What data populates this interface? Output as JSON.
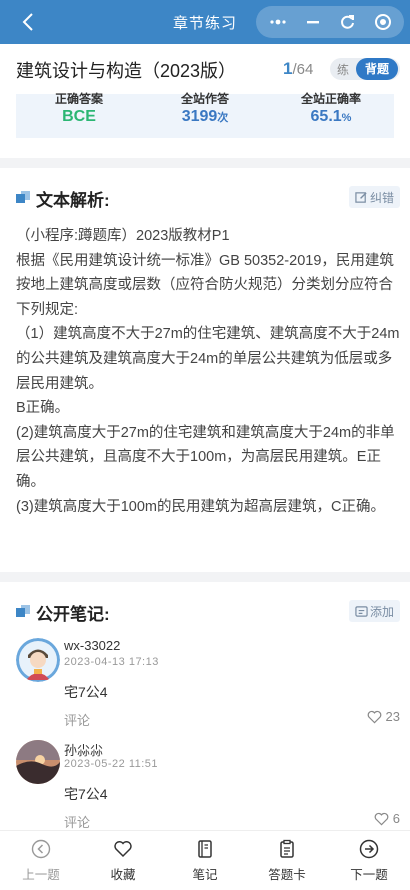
{
  "topbar": {
    "title": "章节练习",
    "back_icon": "chevron-left-icon",
    "capsule_icons": [
      "more-dots-icon",
      "minimize-icon",
      "refresh-icon",
      "target-icon"
    ]
  },
  "header": {
    "book_title": "建筑设计与构造（2023版）",
    "current_page": "1",
    "total_pages": "/64",
    "mode_practice": "练",
    "mode_recite": "背题"
  },
  "stats": {
    "correct_answer_label": "正确答案",
    "correct_answer_value": "BCE",
    "site_attempts_label": "全站作答",
    "site_attempts_value": "3199",
    "site_attempts_unit": "次",
    "site_accuracy_label": "全站正确率",
    "site_accuracy_value": "65.1",
    "site_accuracy_unit": "%"
  },
  "analysis": {
    "title": "文本解析:",
    "report_label": "纠错",
    "lines": [
      "（小程序:蹲题库）2023版教材P1",
      "根据《民用建筑设计统一标准》GB 50352-2019，民用建筑按地上建筑高度或层数（应符合防火规范）分类划分应符合下列规定:",
      "（1）建筑高度不大于27m的住宅建筑、建筑高度不大于24m的公共建筑及建筑高度大于24m的单层公共建筑为低层或多层民用建筑。",
      "B正确。",
      "(2)建筑高度大于27m的住宅建筑和建筑高度大于24m的非单层公共建筑，且高度不大于100m，为高层民用建筑。E正确。",
      "(3)建筑高度大于100m的民用建筑为超高层建筑，C正确。"
    ]
  },
  "notes": {
    "title": "公开笔记:",
    "add_label": "添加",
    "items": [
      {
        "user": "wx-33022",
        "time": "2023-04-13 17:13",
        "text": "宅7公4",
        "comment": "评论",
        "likes": "23"
      },
      {
        "user": "孙尛尛",
        "time": "2023-05-22 11:51",
        "text": "宅7公4",
        "comment": "评论",
        "likes": "6"
      }
    ]
  },
  "bottom_bar": {
    "prev": "上一题",
    "favorite": "收藏",
    "notes": "笔记",
    "answer_card": "答题卡",
    "next": "下一题"
  },
  "colors": {
    "primary": "#3d86c6",
    "correct_green": "#2bb673",
    "stat_blue": "#3a78c2"
  }
}
